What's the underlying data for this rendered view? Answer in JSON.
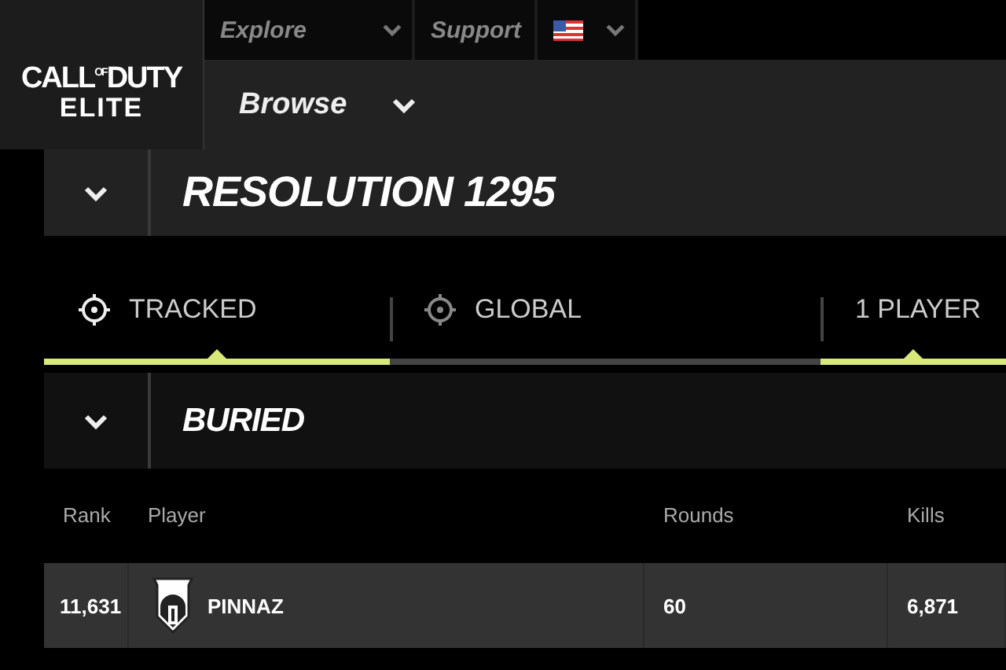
{
  "nav": {
    "logo": {
      "line1": "CALL$^{OF}$DUTY",
      "line2": "ELITE"
    },
    "menus": [
      {
        "label": "Explore"
      },
      {
        "label": "Support"
      }
    ],
    "browse": {
      "label": "Browse"
    }
  },
  "title_bar": {
    "title": "RESOLUTION 1295"
  },
  "tabs": [
    {
      "label": "TRACKED",
      "kind": "target",
      "selected": true
    },
    {
      "label": "GLOBAL",
      "kind": "target",
      "selected": false
    },
    {
      "label": "1 PLAYER",
      "kind": "plain",
      "selected": true
    }
  ],
  "section": {
    "title": "BURIED"
  },
  "table": {
    "columns": [
      "Rank",
      "Player",
      "Rounds",
      "Kills"
    ],
    "rows": [
      {
        "rank": "11,631",
        "player": "PINNAZ",
        "rounds": "60",
        "kills": "6,871"
      }
    ]
  }
}
